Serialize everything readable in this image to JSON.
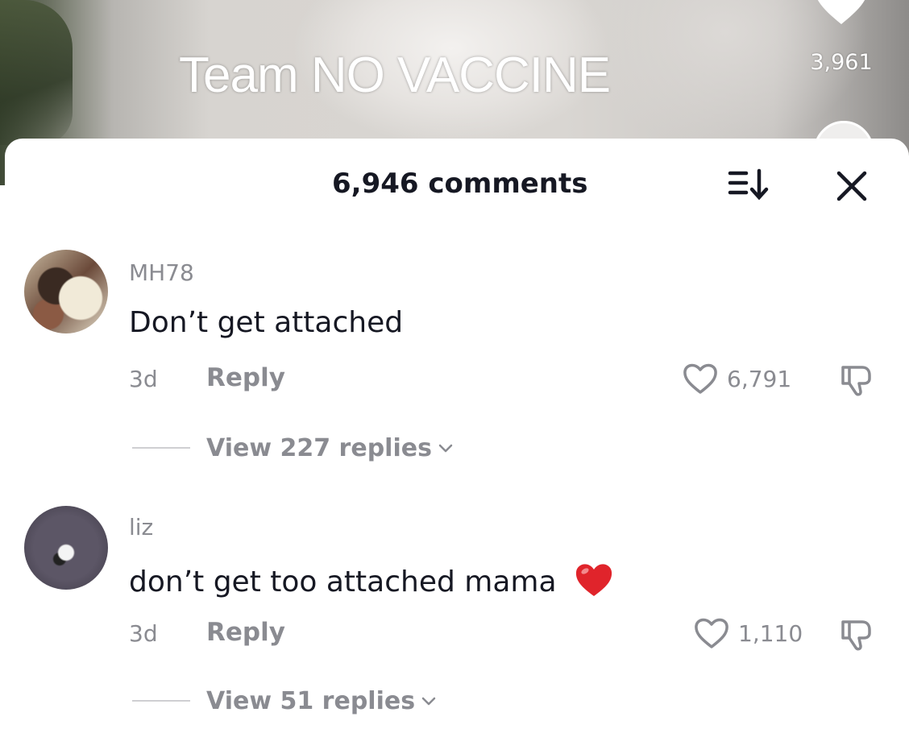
{
  "video": {
    "caption": "Team NO VACCINE",
    "like_count": "3,961"
  },
  "comments_panel": {
    "title": "6,946 comments",
    "icons": {
      "sort": "sort-icon",
      "close": "close-icon"
    }
  },
  "comments": [
    {
      "username": "MH78",
      "text": "Don’t get attached",
      "time": "3d",
      "reply_label": "Reply",
      "likes": "6,791",
      "view_replies": "View 227 replies"
    },
    {
      "username": "liz",
      "text": "don’t get too attached mama",
      "emoji": "red-heart",
      "time": "3d",
      "reply_label": "Reply",
      "likes": "1,110",
      "view_replies": "View 51 replies"
    }
  ],
  "colors": {
    "primary_text": "#161823",
    "secondary_text": "#8a8b91",
    "heart_emoji": "#e0242b"
  }
}
